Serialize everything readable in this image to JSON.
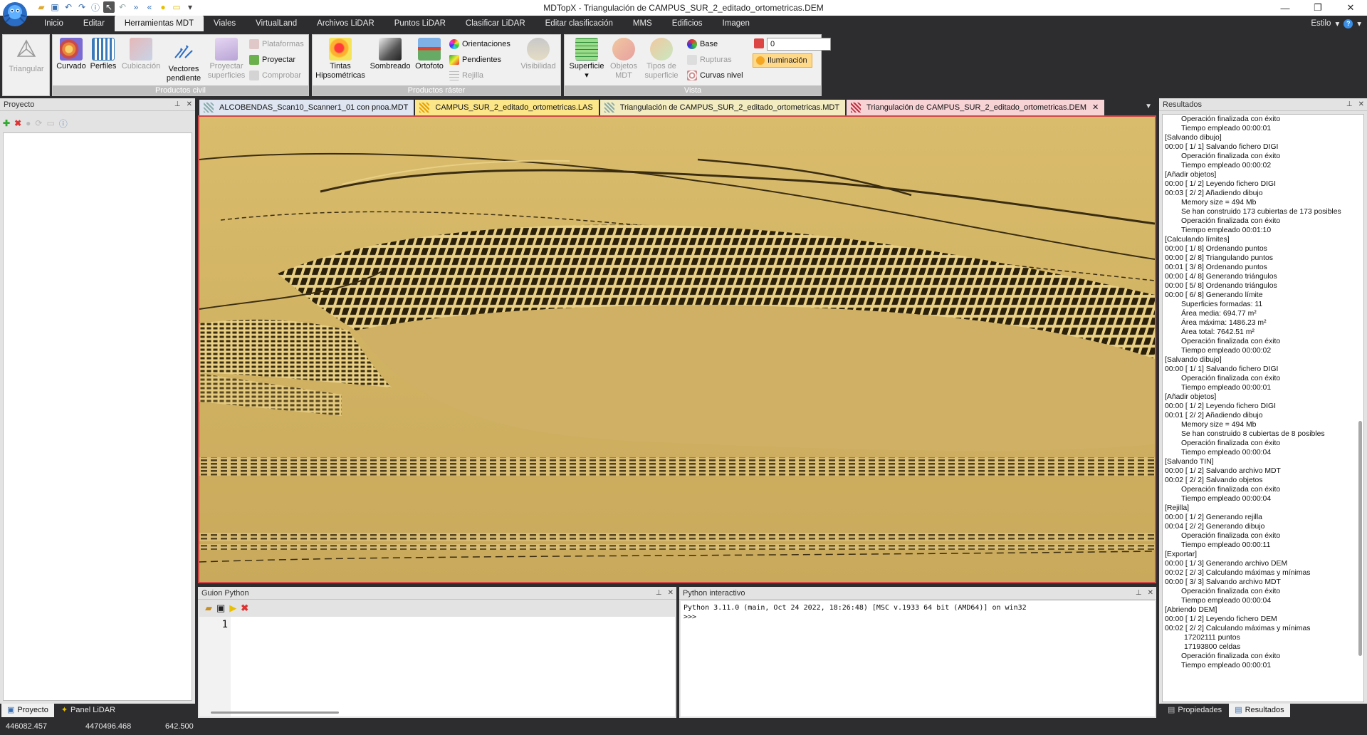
{
  "window": {
    "title": "MDTopX - Triangulación de CAMPUS_SUR_2_editado_ortometricas.DEM",
    "minimize_glyph": "—",
    "maximize_glyph": "❐",
    "close_glyph": "✕"
  },
  "ribbon": {
    "tabs": [
      "Inicio",
      "Editar",
      "Herramientas MDT",
      "Viales",
      "VirtualLand",
      "Archivos LiDAR",
      "Puntos LiDAR",
      "Clasificar LiDAR",
      "Editar clasificación",
      "MMS",
      "Edificios",
      "Imagen"
    ],
    "active_tab": "Herramientas MDT",
    "style_label": "Estilo",
    "help_glyph": "?",
    "triangular": "Triangular",
    "curvado": "Curvado",
    "perfiles": "Perfiles",
    "cubicacion": "Cubicación",
    "vectores_pendiente_1": "Vectores",
    "vectores_pendiente_2": "pendiente",
    "proyectar_superficies_1": "Proyectar",
    "proyectar_superficies_2": "superficies",
    "plataformas": "Plataformas",
    "proyectar": "Proyectar",
    "comprobar": "Comprobar",
    "group_productos_civil": "Productos civil",
    "tintas_1": "Tintas",
    "tintas_2": "Hipsométricas",
    "sombreado": "Sombreado",
    "ortofoto": "Ortofoto",
    "orientaciones": "Orientaciones",
    "pendientes": "Pendientes",
    "rejilla": "Rejilla",
    "visibilidad": "Visibilidad",
    "group_productos_raster": "Productos ráster",
    "superficie": "Superficie",
    "objetos_mdt_1": "Objetos",
    "objetos_mdt_2": "MDT",
    "tipos_superficie_1": "Tipos de",
    "tipos_superficie_2": "superficie",
    "base": "Base",
    "rupturas": "Rupturas",
    "curvas_nivel": "Curvas nivel",
    "spin_value": "0",
    "iluminacion": "Iluminación",
    "group_vista": "Vista"
  },
  "project_panel": {
    "title": "Proyecto",
    "tabs": [
      "Proyecto",
      "Panel LiDAR"
    ]
  },
  "doc_tabs": [
    {
      "label": "ALCOBENDAS_Scan10_Scanner1_01 con pnoa.MDT",
      "bg": "#dfe6f2"
    },
    {
      "label": "CAMPUS_SUR_2_editado_ortometricas.LAS",
      "bg": "#fce68a"
    },
    {
      "label": "Triangulación de CAMPUS_SUR_2_editado_ortometricas.MDT",
      "bg": "#f2ecc0"
    },
    {
      "label": "Triangulación de CAMPUS_SUR_2_editado_ortometricas.DEM",
      "bg": "#f7d3d6"
    }
  ],
  "python_script": {
    "title": "Guion Python",
    "line_number": "1"
  },
  "python_interactive": {
    "title": "Python interactivo",
    "console": "Python 3.11.0 (main, Oct 24 2022, 18:26:48) [MSC v.1933 64 bit (AMD64)] on win32\n>>>"
  },
  "results": {
    "title": "Resultados",
    "lines": [
      {
        "t": "Operación finalizada con éxito",
        "i": 1
      },
      {
        "t": "Tiempo empleado 00:00:01",
        "i": 1
      },
      {
        "t": "[Salvando dibujo]",
        "i": 0
      },
      {
        "t": "00:00 [ 1/ 1] Salvando fichero DIGI",
        "i": 0
      },
      {
        "t": "Operación finalizada con éxito",
        "i": 1
      },
      {
        "t": "Tiempo empleado 00:00:02",
        "i": 1
      },
      {
        "t": "[Añadir objetos]",
        "i": 0
      },
      {
        "t": "00:00 [ 1/ 2] Leyendo fichero DIGI",
        "i": 0
      },
      {
        "t": "00:03 [ 2/ 2] Añadiendo dibujo",
        "i": 0
      },
      {
        "t": "Memory size = 494 Mb",
        "i": 1
      },
      {
        "t": "Se han construido 173 cubiertas de 173 posibles",
        "i": 1
      },
      {
        "t": "Operación finalizada con éxito",
        "i": 1
      },
      {
        "t": "Tiempo empleado 00:01:10",
        "i": 1
      },
      {
        "t": "[Calculando límites]",
        "i": 0
      },
      {
        "t": "00:00 [ 1/ 8] Ordenando puntos",
        "i": 0
      },
      {
        "t": "00:00 [ 2/ 8] Triangulando puntos",
        "i": 0
      },
      {
        "t": "00:01 [ 3/ 8] Ordenando puntos",
        "i": 0
      },
      {
        "t": "00:00 [ 4/ 8] Generando triángulos",
        "i": 0
      },
      {
        "t": "00:00 [ 5/ 8] Ordenando triángulos",
        "i": 0
      },
      {
        "t": "00:00 [ 6/ 8] Generando límite",
        "i": 0
      },
      {
        "t": "Superficies formadas: 11",
        "i": 1
      },
      {
        "t": "Área media: 694.77 m²",
        "i": 1
      },
      {
        "t": "Área máxima: 1486.23 m²",
        "i": 1
      },
      {
        "t": "Área total: 7642.51 m²",
        "i": 1
      },
      {
        "t": "Operación finalizada con éxito",
        "i": 1
      },
      {
        "t": "Tiempo empleado 00:00:02",
        "i": 1
      },
      {
        "t": "[Salvando dibujo]",
        "i": 0
      },
      {
        "t": "00:00 [ 1/ 1] Salvando fichero DIGI",
        "i": 0
      },
      {
        "t": "Operación finalizada con éxito",
        "i": 1
      },
      {
        "t": "Tiempo empleado 00:00:01",
        "i": 1
      },
      {
        "t": "[Añadir objetos]",
        "i": 0
      },
      {
        "t": "00:00 [ 1/ 2] Leyendo fichero DIGI",
        "i": 0
      },
      {
        "t": "00:01 [ 2/ 2] Añadiendo dibujo",
        "i": 0
      },
      {
        "t": "Memory size = 494 Mb",
        "i": 1
      },
      {
        "t": "Se han construido 8 cubiertas de 8 posibles",
        "i": 1
      },
      {
        "t": "Operación finalizada con éxito",
        "i": 1
      },
      {
        "t": "Tiempo empleado 00:00:04",
        "i": 1
      },
      {
        "t": "[Salvando TIN]",
        "i": 0
      },
      {
        "t": "00:00 [ 1/ 2] Salvando archivo MDT",
        "i": 0
      },
      {
        "t": "00:02 [ 2/ 2] Salvando objetos",
        "i": 0
      },
      {
        "t": "Operación finalizada con éxito",
        "i": 1
      },
      {
        "t": "Tiempo empleado 00:00:04",
        "i": 1
      },
      {
        "t": "[Rejilla]",
        "i": 0
      },
      {
        "t": "00:00 [ 1/ 2] Generando rejilla",
        "i": 0
      },
      {
        "t": "00:04 [ 2/ 2] Generando dibujo",
        "i": 0
      },
      {
        "t": "Operación finalizada con éxito",
        "i": 1
      },
      {
        "t": "Tiempo empleado 00:00:11",
        "i": 1
      },
      {
        "t": "[Exportar]",
        "i": 0
      },
      {
        "t": "00:00 [ 1/ 3] Generando archivo DEM",
        "i": 0
      },
      {
        "t": "00:02 [ 2/ 3] Calculando máximas y mínimas",
        "i": 0
      },
      {
        "t": "00:00 [ 3/ 3] Salvando archivo MDT",
        "i": 0
      },
      {
        "t": "Operación finalizada con éxito",
        "i": 1
      },
      {
        "t": "Tiempo empleado 00:00:04",
        "i": 1
      },
      {
        "t": "[Abriendo DEM]",
        "i": 0
      },
      {
        "t": "00:00 [ 1/ 2] Leyendo fichero DEM",
        "i": 0
      },
      {
        "t": "00:02 [ 2/ 2] Calculando máximas y mínimas",
        "i": 0
      },
      {
        "t": "17202111 puntos",
        "i": 2
      },
      {
        "t": "17193800 celdas",
        "i": 2
      },
      {
        "t": "Operación finalizada con éxito",
        "i": 1
      },
      {
        "t": "Tiempo empleado 00:00:01",
        "i": 1
      }
    ],
    "tabs": [
      "Propiedades",
      "Resultados"
    ]
  },
  "statusbar": {
    "x": "446082.457",
    "y": "4470496.468",
    "z": "642.500"
  },
  "colors": {
    "terrain": "#c9a95b",
    "terrain_light": "#e3c77a",
    "terrain_dark": "#3a2c10",
    "chrome_dark": "#2d2d30",
    "accent_red": "#d04848"
  }
}
